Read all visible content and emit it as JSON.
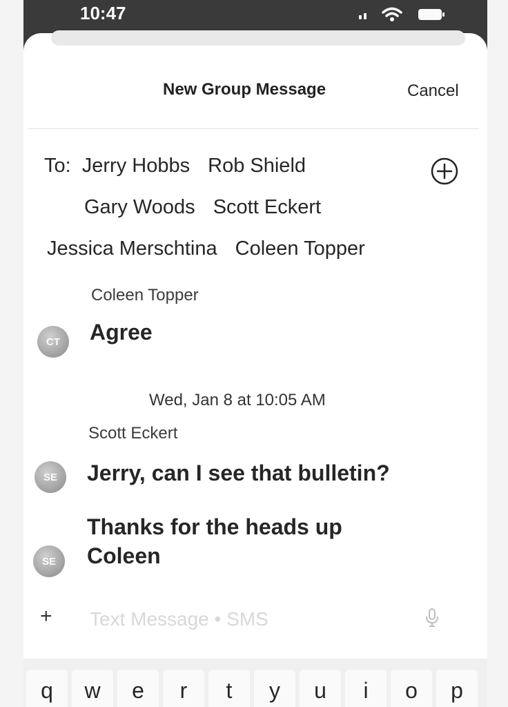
{
  "status_bar": {
    "time": "10:47"
  },
  "header": {
    "title": "New Group Message",
    "cancel_label": "Cancel"
  },
  "recipients": {
    "to_label": "To:",
    "lines": [
      [
        "Jerry Hobbs",
        "Rob Shield"
      ],
      [
        "Gary Woods",
        "Scott Eckert"
      ],
      [
        "Jessica Merschtina",
        "Coleen Topper"
      ]
    ]
  },
  "conversation": {
    "messages": [
      {
        "sender": "Coleen Topper",
        "avatar_initials": "CT",
        "text": "Agree"
      },
      {
        "sender": "Scott Eckert",
        "avatar_initials": "SE",
        "text": "Jerry, can I see that bulletin?"
      },
      {
        "avatar_initials": "SE",
        "text": "Thanks for the heads up Coleen"
      }
    ],
    "timestamp": "Wed, Jan 8 at 10:05 AM"
  },
  "compose": {
    "placeholder": "Text Message • SMS",
    "value": ""
  },
  "keyboard": {
    "row1": [
      "q",
      "w",
      "e",
      "r",
      "t",
      "y",
      "u",
      "i",
      "o",
      "p"
    ]
  },
  "icons": {
    "add_recipient": "plus-circle-icon",
    "attach": "plus-icon",
    "dictation": "microphone-icon",
    "signal": "signal-bars-icon",
    "wifi": "wifi-icon",
    "battery": "battery-icon"
  }
}
